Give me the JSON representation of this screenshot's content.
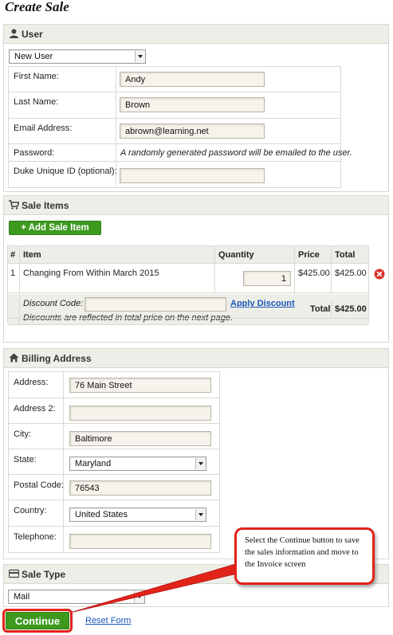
{
  "page_title": "Create Sale",
  "user": {
    "section_title": "User",
    "user_select": "New User",
    "fields": [
      {
        "label": "First Name:",
        "value": "Andy"
      },
      {
        "label": "Last Name:",
        "value": "Brown"
      },
      {
        "label": "Email Address:",
        "value": "abrown@learning.net"
      }
    ],
    "password_label": "Password:",
    "password_note": "A randomly generated password will be emailed to the user.",
    "duke_id_label": "Duke Unique ID (optional):",
    "duke_id_value": ""
  },
  "sale_items": {
    "section_title": "Sale Items",
    "add_button": "+ Add Sale Item",
    "columns": [
      "#",
      "Item",
      "Quantity",
      "Price",
      "Total"
    ],
    "rows": [
      {
        "num": "1",
        "item": "Changing From Within March 2015",
        "quantity": "1",
        "price": "$425.00",
        "total": "$425.00"
      }
    ],
    "discount_label": "Discount Code:",
    "discount_value": "",
    "apply_discount": "Apply Discount",
    "discount_note": "Discounts are reflected in total price on the next page.",
    "total_label": "Total",
    "total_value": "$425.00"
  },
  "billing": {
    "section_title": "Billing Address",
    "address_label": "Address:",
    "address_value": "76 Main Street",
    "address2_label": "Address 2:",
    "address2_value": "",
    "city_label": "City:",
    "city_value": "Baltimore",
    "state_label": "State:",
    "state_value": "Maryland",
    "postal_label": "Postal Code:",
    "postal_value": "76543",
    "country_label": "Country:",
    "country_value": "United States",
    "telephone_label": "Telephone:",
    "telephone_value": ""
  },
  "sale_type": {
    "section_title": "Sale Type",
    "value": "Mail"
  },
  "actions": {
    "continue": "Continue",
    "reset": "Reset Form"
  },
  "callout": "Select the Continue button to save the sales information and move to the Invoice screen",
  "colors": {
    "accent_green": "#3d9a1f",
    "link_blue": "#1a57b8",
    "annotation_red": "#e2231a",
    "remove_red": "#d9332b"
  }
}
